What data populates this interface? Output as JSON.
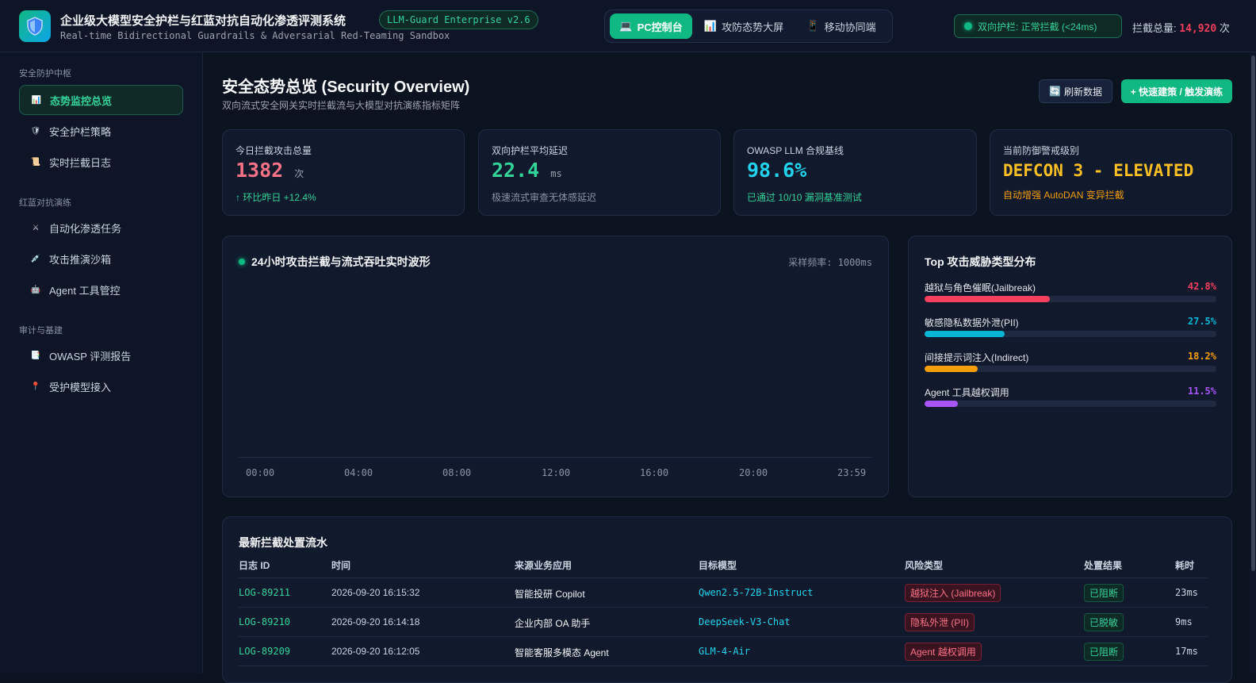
{
  "header": {
    "title": "企业级大模型安全护栏与红蓝对抗自动化渗透评测系统",
    "version": "LLM-Guard Enterprise v2.6",
    "subtitle": "Real-time Bidirectional Guardrails & Adversarial Red-Teaming Sandbox",
    "logo_icon": "shield-icon",
    "views": [
      {
        "label": "PC控制台",
        "icon": "laptop-icon",
        "active": true
      },
      {
        "label": "攻防态势大屏",
        "icon": "bar-chart-icon",
        "active": false
      },
      {
        "label": "移动协同端",
        "icon": "mobile-icon",
        "active": false
      }
    ],
    "status": "双向护栏: 正常拦截 (<24ms)",
    "total_label": "拦截总量:",
    "total_value": "14,920",
    "total_unit": "次"
  },
  "sidebar": {
    "groups": [
      {
        "title": "安全防护中枢",
        "items": [
          {
            "label": "态势监控总览",
            "icon": "bar-chart-icon",
            "active": true
          },
          {
            "label": "安全护栏策略",
            "icon": "shield-icon",
            "active": false
          },
          {
            "label": "实时拦截日志",
            "icon": "scroll-icon",
            "active": false
          }
        ]
      },
      {
        "title": "红蓝对抗演练",
        "items": [
          {
            "label": "自动化渗透任务",
            "icon": "crossed-swords-icon",
            "active": false
          },
          {
            "label": "攻击推演沙箱",
            "icon": "syringe-icon",
            "active": false
          },
          {
            "label": "Agent 工具管控",
            "icon": "robot-icon",
            "active": false
          }
        ]
      },
      {
        "title": "审计与基建",
        "items": [
          {
            "label": "OWASP 评测报告",
            "icon": "document-icon",
            "active": false
          },
          {
            "label": "受护模型接入",
            "icon": "pin-icon",
            "active": false
          }
        ]
      }
    ]
  },
  "main": {
    "title": "安全态势总览 (Security Overview)",
    "subtitle": "双向流式安全网关实时拦截流与大模型对抗演练指标矩阵",
    "refresh_label": "刷新数据",
    "primary_label": "+ 快速建策 / 触发演练"
  },
  "kpis": [
    {
      "label": "今日拦截攻击总量",
      "value": "1382",
      "unit": "次",
      "foot": "↑ 环比昨日 +12.4%",
      "color": "#fb7185",
      "foot_color": "#34d399"
    },
    {
      "label": "双向护栏平均延迟",
      "value": "22.4",
      "unit": "ms",
      "foot": "极速流式审查无体感延迟",
      "color": "#34d399",
      "foot_color": "#8b94a7"
    },
    {
      "label": "OWASP LLM 合规基线",
      "value": "98.6%",
      "unit": "",
      "foot": "已通过 10/10 漏洞基准测试",
      "color": "#22d3ee",
      "foot_color": "#34d399"
    },
    {
      "label": "当前防御警戒级别",
      "value": "DEFCON 3 - ELEVATED",
      "unit": "",
      "foot": "自动增强 AutoDAN 变异拦截",
      "color": "#fbbf24",
      "foot_color": "#f59e0b"
    }
  ],
  "wave": {
    "title": "24小时攻击拦截与流式吞吐实时波形",
    "rate": "采样频率: 1000ms",
    "ticks": [
      "00:00",
      "04:00",
      "08:00",
      "12:00",
      "16:00",
      "20:00",
      "23:59"
    ]
  },
  "threats": {
    "title": "Top 攻击威胁类型分布",
    "items": [
      {
        "name": "越狱与角色催眠(Jailbreak)",
        "pct": "42.8%",
        "value": 42.8,
        "color": "#f43f5e"
      },
      {
        "name": "敏感隐私数据外泄(PII)",
        "pct": "27.5%",
        "value": 27.5,
        "color": "#06b6d4"
      },
      {
        "name": "间接提示词注入(Indirect)",
        "pct": "18.2%",
        "value": 18.2,
        "color": "#f59e0b"
      },
      {
        "name": "Agent 工具越权调用",
        "pct": "11.5%",
        "value": 11.5,
        "color": "#a855f7"
      }
    ]
  },
  "log_table": {
    "title": "最新拦截处置流水",
    "headers": [
      "日志 ID",
      "时间",
      "来源业务应用",
      "目标模型",
      "风险类型",
      "处置结果",
      "耗时"
    ],
    "rows": [
      [
        "LOG-89211",
        "2026-09-20 16:15:32",
        "智能投研 Copilot",
        "Qwen2.5-72B-Instruct",
        "越狱注入 (Jailbreak)",
        "已阻断",
        "23ms"
      ],
      [
        "LOG-89210",
        "2026-09-20 16:14:18",
        "企业内部 OA 助手",
        "DeepSeek-V3-Chat",
        "隐私外泄 (PII)",
        "已脱敏",
        "9ms"
      ],
      [
        "LOG-89209",
        "2026-09-20 16:12:05",
        "智能客服多模态 Agent",
        "GLM-4-Air",
        "Agent 越权调用",
        "已阻断",
        "17ms"
      ]
    ]
  }
}
